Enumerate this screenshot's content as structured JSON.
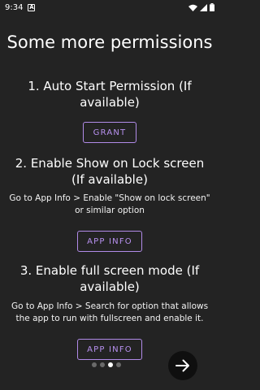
{
  "status_bar": {
    "time": "9:34",
    "notification_icon": "a-box-icon",
    "wifi_icon": "wifi-icon",
    "signal_icon": "signal-icon",
    "battery_icon": "battery-icon"
  },
  "title": "Some more permissions",
  "sections": [
    {
      "heading": "1. Auto Start Permission (If available)",
      "description": "",
      "button_label": "GRANT"
    },
    {
      "heading": "2. Enable Show on Lock screen (If available)",
      "description": "Go to App Info > Enable \"Show on lock screen\" or similar option",
      "button_label": "APP INFO"
    },
    {
      "heading": "3. Enable full screen mode (If available)",
      "description": "Go to App Info > Search for option that allows the app to run with fullscreen and enable it.",
      "button_label": "APP INFO"
    }
  ],
  "pager": {
    "total": 4,
    "active_index": 2
  },
  "next_button_icon": "arrow-right-icon",
  "colors": {
    "background": "#232323",
    "accent": "#b18be8",
    "text": "#ffffff"
  }
}
